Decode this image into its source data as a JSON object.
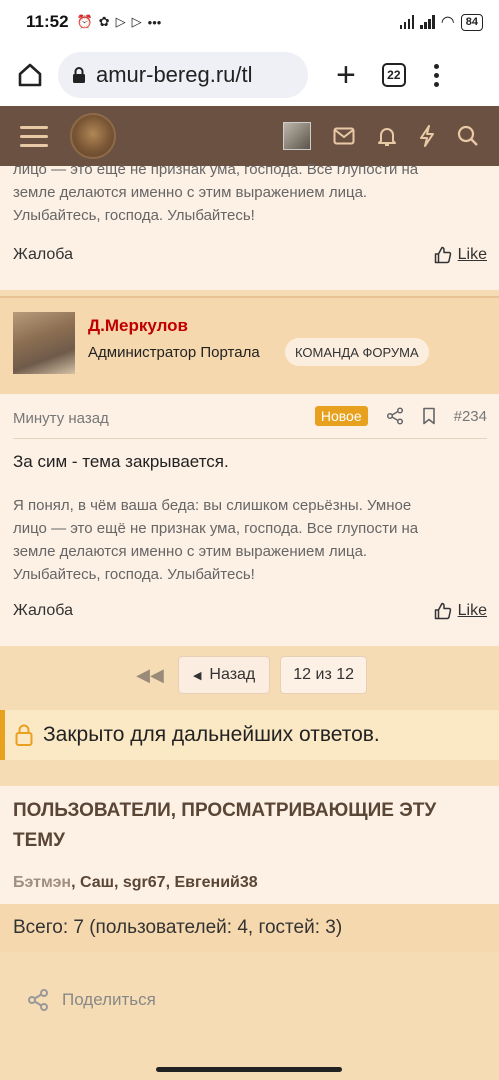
{
  "status_bar": {
    "time": "11:52",
    "battery": "84"
  },
  "browser": {
    "url": "amur-bereg.ru/tl",
    "tab_count": "22"
  },
  "post1": {
    "quote_lines": [
      "лицо — это ещё не признак ума, господа. Все глупости на",
      "земле делаются именно с этим выражением лица.",
      "Улыбайтесь, господа. Улыбайтесь!"
    ],
    "report_label": "Жалоба",
    "like_label": "Like"
  },
  "post2": {
    "author": "Д.Меркулов",
    "role": "Администратор Портала",
    "badge": "КОМАНДА ФОРУМА",
    "time": "Минуту назад",
    "new_label": "Новое",
    "number": "#234",
    "message": "За сим - тема закрывается.",
    "quote_lines": [
      "Я понял, в чём ваша беда: вы слишком серьёзны. Умное",
      "лицо — это ещё не признак ума, господа. Все глупости на",
      "земле делаются именно с этим выражением лица.",
      "Улыбайтесь, господа. Улыбайтесь!"
    ],
    "report_label": "Жалоба",
    "like_label": "Like"
  },
  "pager": {
    "prev_label": "Назад",
    "current": "12 из 12"
  },
  "closed_notice": "Закрыто для дальнейших ответов.",
  "viewers": {
    "title_line1": "ПОЛЬЗОВАТЕЛИ, ПРОСМАТРИВАЮЩИЕ ЭТУ",
    "title_line2": "ТЕМУ",
    "users": [
      "Бэтмэн",
      "Саш",
      "sgr67",
      "Евгений38"
    ],
    "totals": "Всего: 7 (пользователей: 4, гостей: 3)"
  },
  "share_label": "Поделиться",
  "colors": {
    "header": "#6b5142",
    "accent": "#e8a11e",
    "author": "#c00000"
  }
}
